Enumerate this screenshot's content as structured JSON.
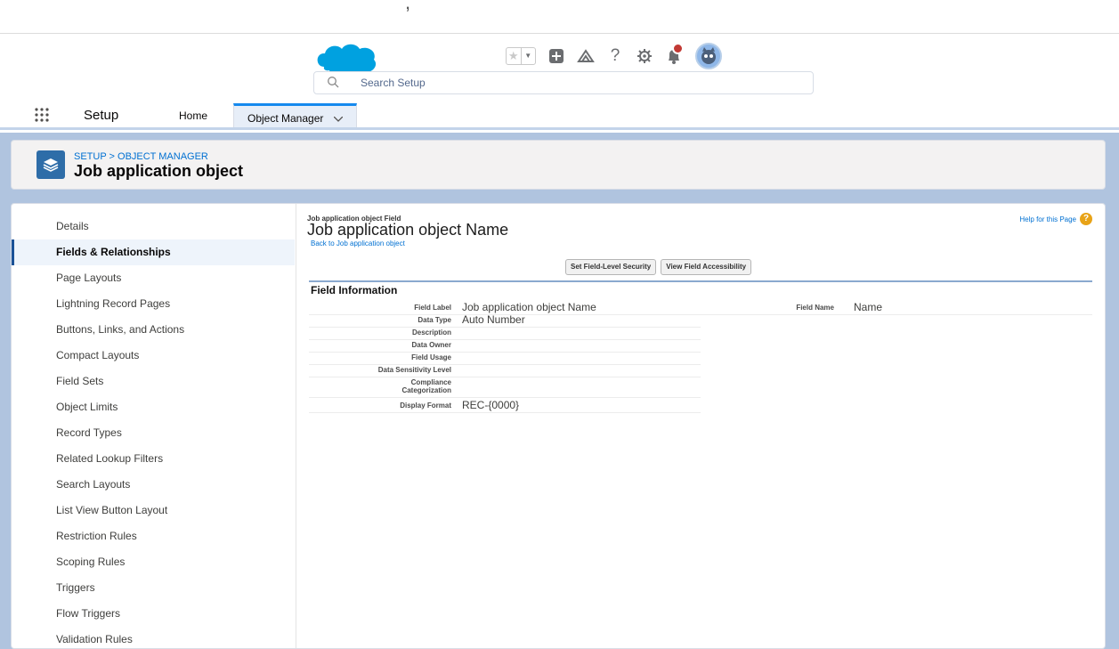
{
  "header": {
    "search_placeholder": "Search Setup",
    "icons": [
      "star-icon",
      "chevron-down-icon",
      "plus-icon",
      "trailhead-icon",
      "help-icon",
      "gear-icon",
      "bell-icon",
      "avatar"
    ],
    "brand_color": "#00a1e0"
  },
  "appnav": {
    "app_name": "Setup",
    "tabs": [
      {
        "label": "Home"
      },
      {
        "label": "Object Manager"
      }
    ]
  },
  "object_header": {
    "breadcrumb": "SETUP > OBJECT MANAGER",
    "title": "Job application object"
  },
  "sidebar": {
    "items": [
      {
        "label": "Details"
      },
      {
        "label": "Fields & Relationships",
        "active": true
      },
      {
        "label": "Page Layouts"
      },
      {
        "label": "Lightning Record Pages"
      },
      {
        "label": "Buttons, Links, and Actions"
      },
      {
        "label": "Compact Layouts"
      },
      {
        "label": "Field Sets"
      },
      {
        "label": "Object Limits"
      },
      {
        "label": "Record Types"
      },
      {
        "label": "Related Lookup Filters"
      },
      {
        "label": "Search Layouts"
      },
      {
        "label": "List View Button Layout"
      },
      {
        "label": "Restriction Rules"
      },
      {
        "label": "Scoping Rules"
      },
      {
        "label": "Triggers"
      },
      {
        "label": "Flow Triggers"
      },
      {
        "label": "Validation Rules"
      }
    ]
  },
  "field_page": {
    "caption": "Job application object Field",
    "title": "Job application object Name",
    "back_link": "Back to Job application object",
    "help_link": "Help for this Page",
    "buttons": [
      "Set Field-Level Security",
      "View Field Accessibility"
    ],
    "section_title": "Field Information",
    "left_fields": [
      {
        "label": "Field Label",
        "value": "Job application object Name"
      },
      {
        "label": "Data Type",
        "value": "Auto Number"
      },
      {
        "label": "Description",
        "value": ""
      },
      {
        "label": "Data Owner",
        "value": ""
      },
      {
        "label": "Field Usage",
        "value": ""
      },
      {
        "label": "Data Sensitivity Level",
        "value": ""
      },
      {
        "label_line1": "Compliance",
        "label_line2": "Categorization",
        "value": ""
      },
      {
        "label": "Display Format",
        "value": "REC-{0000}"
      }
    ],
    "right_fields": [
      {
        "label": "Field Name",
        "value": "Name"
      }
    ]
  }
}
